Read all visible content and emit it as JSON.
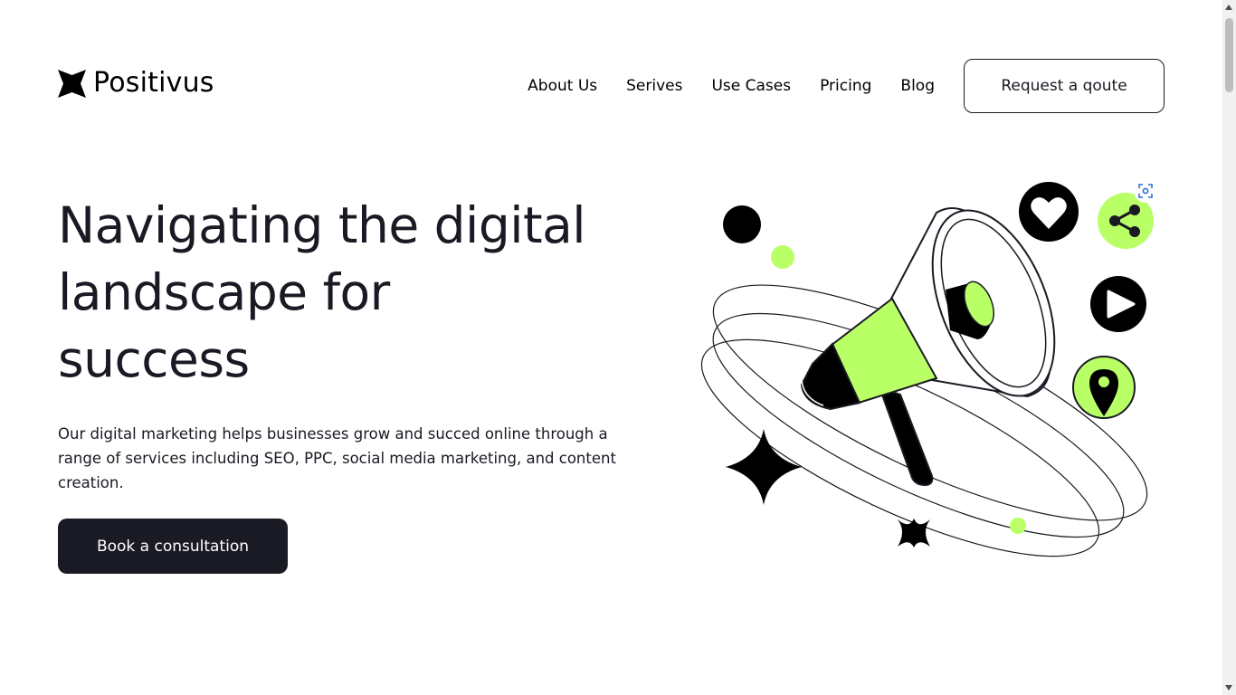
{
  "header": {
    "logo_text": "Positivus",
    "nav": [
      {
        "label": "About Us",
        "id": "about-us"
      },
      {
        "label": "Serives",
        "id": "services"
      },
      {
        "label": "Use Cases",
        "id": "use-cases"
      },
      {
        "label": "Pricing",
        "id": "pricing"
      },
      {
        "label": "Blog",
        "id": "blog"
      }
    ],
    "cta_label": "Request a qoute"
  },
  "hero": {
    "title_line1": "Navigating the digital",
    "title_line2": "landscape for",
    "title_line3": "success",
    "description": "Our digital marketing helps businesses grow and succed online through a range of services including SEO, PPC, social media marketing, and content creation.",
    "cta_label": "Book a consultation"
  },
  "illustration": {
    "icons": [
      "megaphone-icon",
      "heart-icon",
      "share-icon",
      "play-icon",
      "location-pin-icon",
      "sparkle-star-icon"
    ]
  },
  "colors": {
    "accent_green": "#b9ff66",
    "dark": "#191a23",
    "white": "#ffffff"
  }
}
